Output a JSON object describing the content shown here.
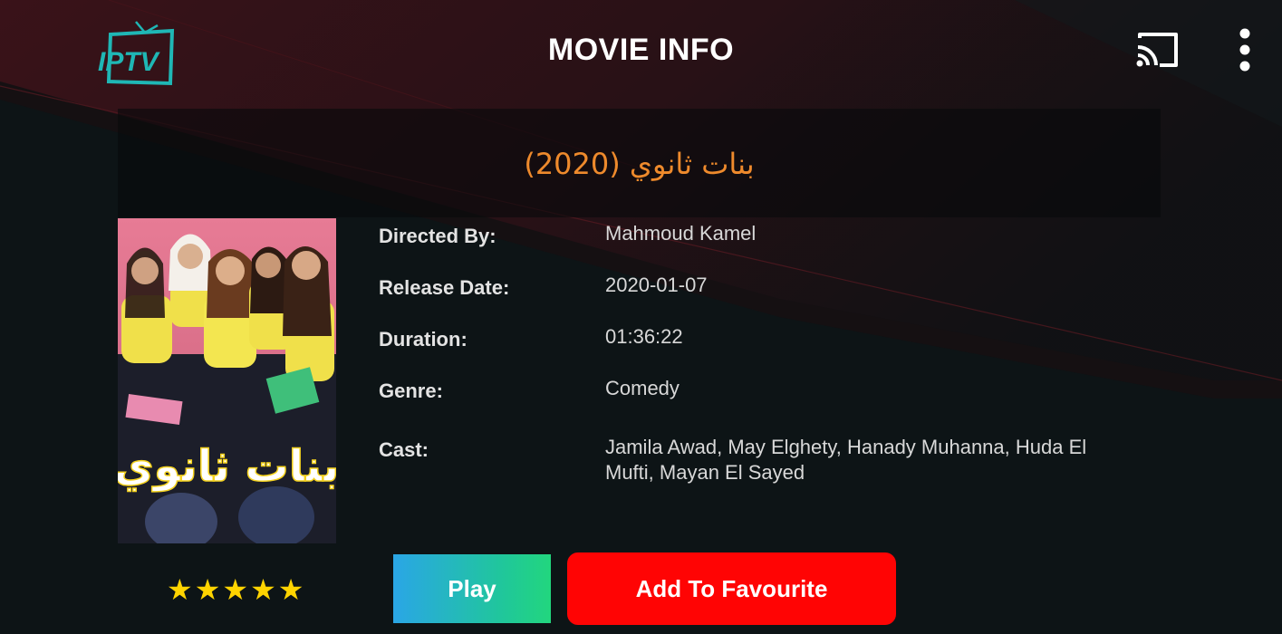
{
  "header": {
    "logo_text": "IPTV",
    "title": "MOVIE INFO",
    "cast_icon": "cast-icon",
    "more_icon": "more-vertical-icon"
  },
  "movie": {
    "title": "بنات ثانوي (2020)",
    "poster_title_ar": "بنات ثانوي",
    "rating": 5,
    "rating_max": 5
  },
  "info": [
    {
      "label": "Directed By:",
      "value": "Mahmoud Kamel"
    },
    {
      "label": "Release Date:",
      "value": "2020-01-07"
    },
    {
      "label": "Duration:",
      "value": "01:36:22"
    },
    {
      "label": "Genre:",
      "value": "Comedy"
    },
    {
      "label": "Cast:",
      "value": "Jamila Awad, May Elghety, Hanady Muhanna, Huda El Mufti, Mayan El Sayed"
    }
  ],
  "actions": {
    "play_label": "Play",
    "favourite_label": "Add To Favourite"
  },
  "colors": {
    "title_orange": "#ee8a2c",
    "favourite_red": "#ff0404",
    "star_yellow": "#ffd400",
    "play_gradient_start": "#2aa6e6",
    "play_gradient_end": "#22d67e",
    "logo_teal": "#1fb7b5"
  }
}
